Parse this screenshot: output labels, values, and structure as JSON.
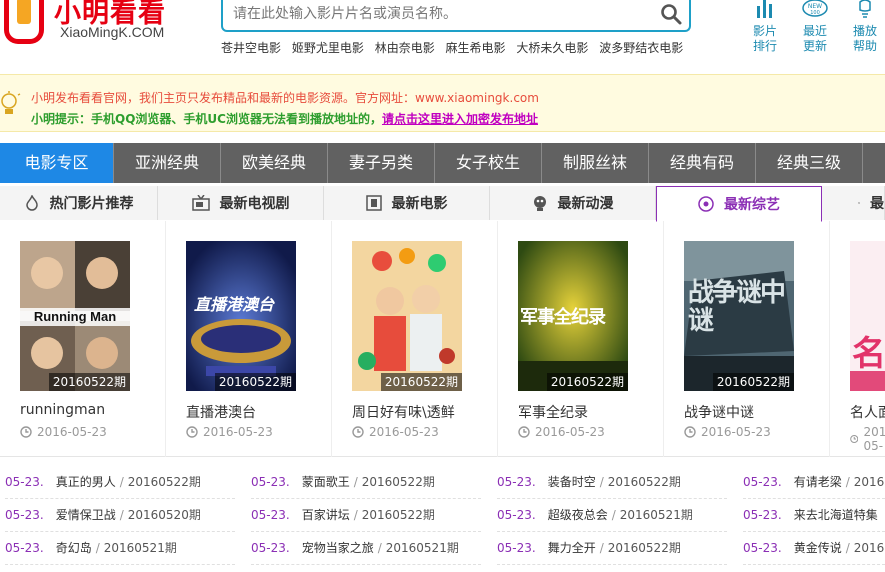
{
  "header": {
    "logo_title": "小明看看",
    "logo_domain": "XiaoMingK.COM",
    "search_placeholder": "请在此处输入影片片名或演员名称。",
    "hot_links": [
      "苍井空电影",
      "姬野尤里电影",
      "林由奈电影",
      "麻生希电影",
      "大桥未久电影",
      "波多野结衣电影"
    ],
    "icons": [
      {
        "icon": "chart-icon",
        "label1": "影片",
        "label2": "排行"
      },
      {
        "icon": "new-icon",
        "label1": "最近",
        "label2": "更新"
      },
      {
        "icon": "help-icon",
        "label1": "播放",
        "label2": "帮助"
      }
    ]
  },
  "notice": {
    "line1": "小明发布看看官网，我们主页只发布精品和最新的电影资源。官方网址：",
    "line1_url": "www.xiaomingk.com",
    "line2": "小明提示：手机QQ浏览器、手机UC浏览器无法看到播放地址的，",
    "line2_link": "请点击这里进入加密发布地址"
  },
  "nav": [
    "电影专区",
    "亚洲经典",
    "欧美经典",
    "妻子另类",
    "女子校生",
    "制服丝袜",
    "经典有码",
    "经典三级"
  ],
  "tabs": [
    {
      "label": "热门影片推荐",
      "icon": "fire-icon"
    },
    {
      "label": "最新电视剧",
      "icon": "tv-icon"
    },
    {
      "label": "最新电影",
      "icon": "film-icon"
    },
    {
      "label": "最新动漫",
      "icon": "anime-icon"
    },
    {
      "label": "最新综艺",
      "icon": "target-icon"
    },
    {
      "label": "最",
      "icon": "tag-icon"
    }
  ],
  "cards": [
    {
      "title": "runningman",
      "date": "2016-05-23",
      "ep": "20160522期",
      "poster_text": "Running Man"
    },
    {
      "title": "直播港澳台",
      "date": "2016-05-23",
      "ep": "20160522期",
      "poster_text": "直播港澳台"
    },
    {
      "title": "周日好有味\\透鲜",
      "date": "2016-05-23",
      "ep": "20160522期",
      "poster_text": ""
    },
    {
      "title": "军事全纪录",
      "date": "2016-05-23",
      "ep": "20160522期",
      "poster_text": "军事全纪录"
    },
    {
      "title": "战争谜中谜",
      "date": "2016-05-23",
      "ep": "20160522期",
      "poster_text": "战争谜中谜"
    },
    {
      "title": "名人面",
      "date": "2016-05-",
      "ep": "",
      "poster_text": "名"
    }
  ],
  "lists": [
    [
      {
        "date": "05-23.",
        "name": "真正的男人",
        "ep": "20160522期"
      },
      {
        "date": "05-23.",
        "name": "爱情保卫战",
        "ep": "20160520期"
      },
      {
        "date": "05-23.",
        "name": "奇幻岛",
        "ep": "20160521期"
      }
    ],
    [
      {
        "date": "05-23.",
        "name": "蒙面歌王",
        "ep": "20160522期"
      },
      {
        "date": "05-23.",
        "name": "百家讲坛",
        "ep": "20160522期"
      },
      {
        "date": "05-23.",
        "name": "宠物当家之旅",
        "ep": "20160521期"
      }
    ],
    [
      {
        "date": "05-23.",
        "name": "装备时空",
        "ep": "20160522期"
      },
      {
        "date": "05-23.",
        "name": "超级夜总会",
        "ep": "20160521期"
      },
      {
        "date": "05-23.",
        "name": "舞力全开",
        "ep": "20160522期"
      }
    ],
    [
      {
        "date": "05-23.",
        "name": "有请老梁",
        "ep": "2016"
      },
      {
        "date": "05-23.",
        "name": "来去北海道特集",
        "ep": ""
      },
      {
        "date": "05-23.",
        "name": "黄金传说",
        "ep": "2016"
      }
    ]
  ]
}
